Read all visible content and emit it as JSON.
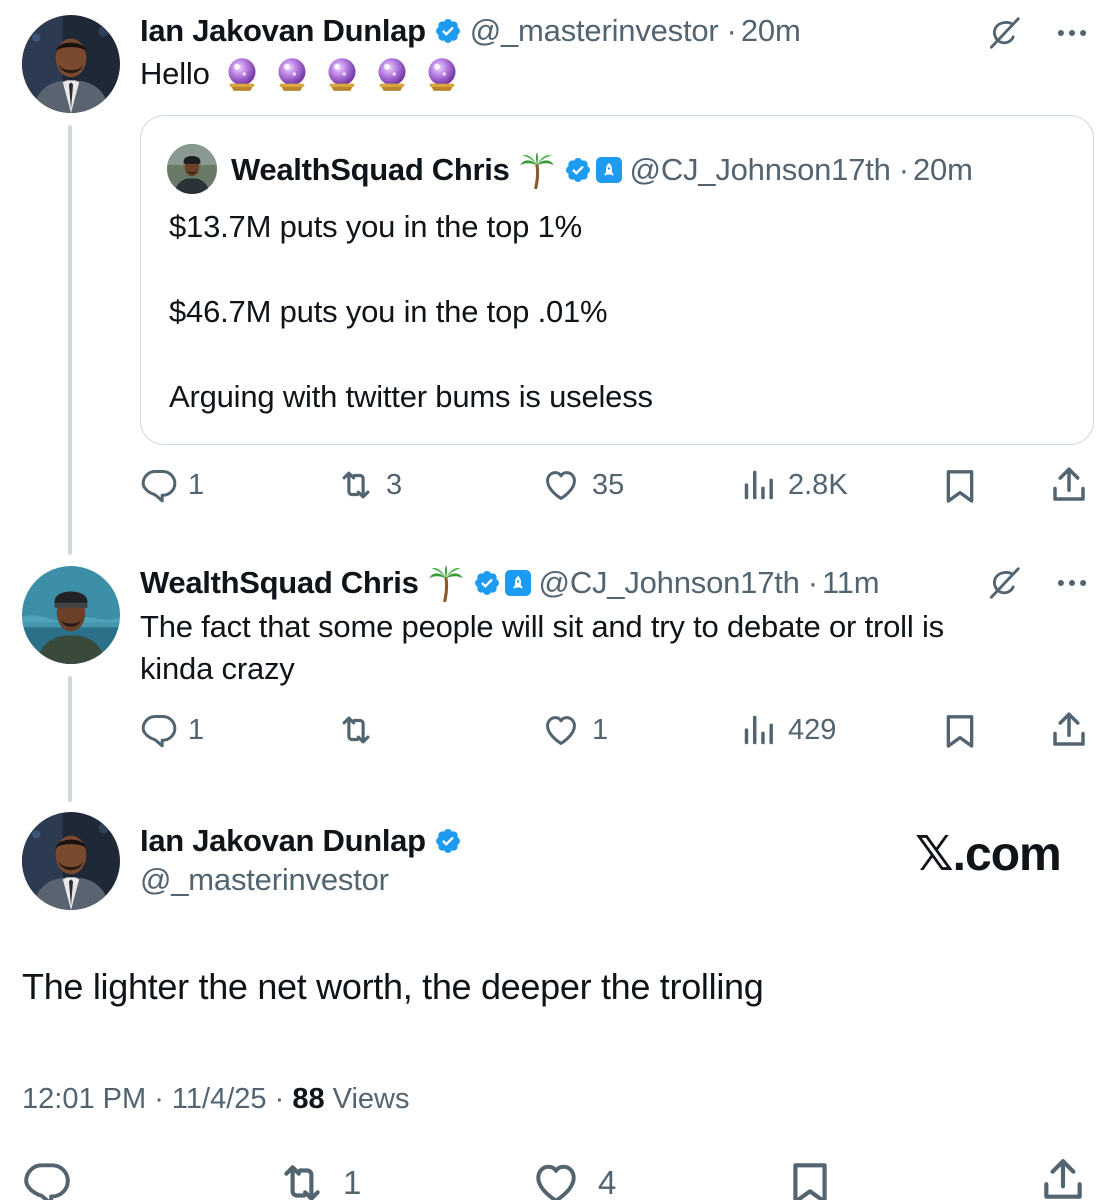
{
  "post1": {
    "author_name": "Ian Jakovan Dunlap",
    "handle": "@_masterinvestor",
    "time": "20m",
    "text": "Hello",
    "emojis": [
      "🔮",
      "🔮",
      "🔮",
      "🔮",
      "🔮"
    ],
    "quote": {
      "author_name": "WealthSquad Chris",
      "name_emoji": "🌴",
      "handle": "@CJ_Johnson17th",
      "time": "20m",
      "lines": [
        "$13.7M puts you in the top 1%",
        "$46.7M puts you in the top .01%",
        "Arguing with twitter bums is useless"
      ]
    },
    "actions": {
      "replies": "1",
      "reposts": "3",
      "likes": "35",
      "views": "2.8K"
    }
  },
  "post2": {
    "author_name": "WealthSquad Chris",
    "name_emoji": "🌴",
    "handle": "@CJ_Johnson17th",
    "time": "11m",
    "text_line1": "The fact that some people will sit and try to debate or troll is",
    "text_line2": "kinda crazy",
    "actions": {
      "replies": "1",
      "reposts": "",
      "likes": "1",
      "views": "429"
    }
  },
  "main_post": {
    "author_name": "Ian Jakovan Dunlap",
    "handle": "@_masterinvestor",
    "brand": "𝕏.com",
    "text": "The lighter the net worth, the deeper the trolling",
    "time": "12:01 PM",
    "date": "11/4/25",
    "views_count": "88",
    "views_label": "Views",
    "actions": {
      "reposts": "1",
      "likes": "4"
    }
  },
  "colors": {
    "verified": "#1d9bf0",
    "muted": "#536471",
    "border": "#cfd9de",
    "crystal_ball": "#9b59d0"
  }
}
